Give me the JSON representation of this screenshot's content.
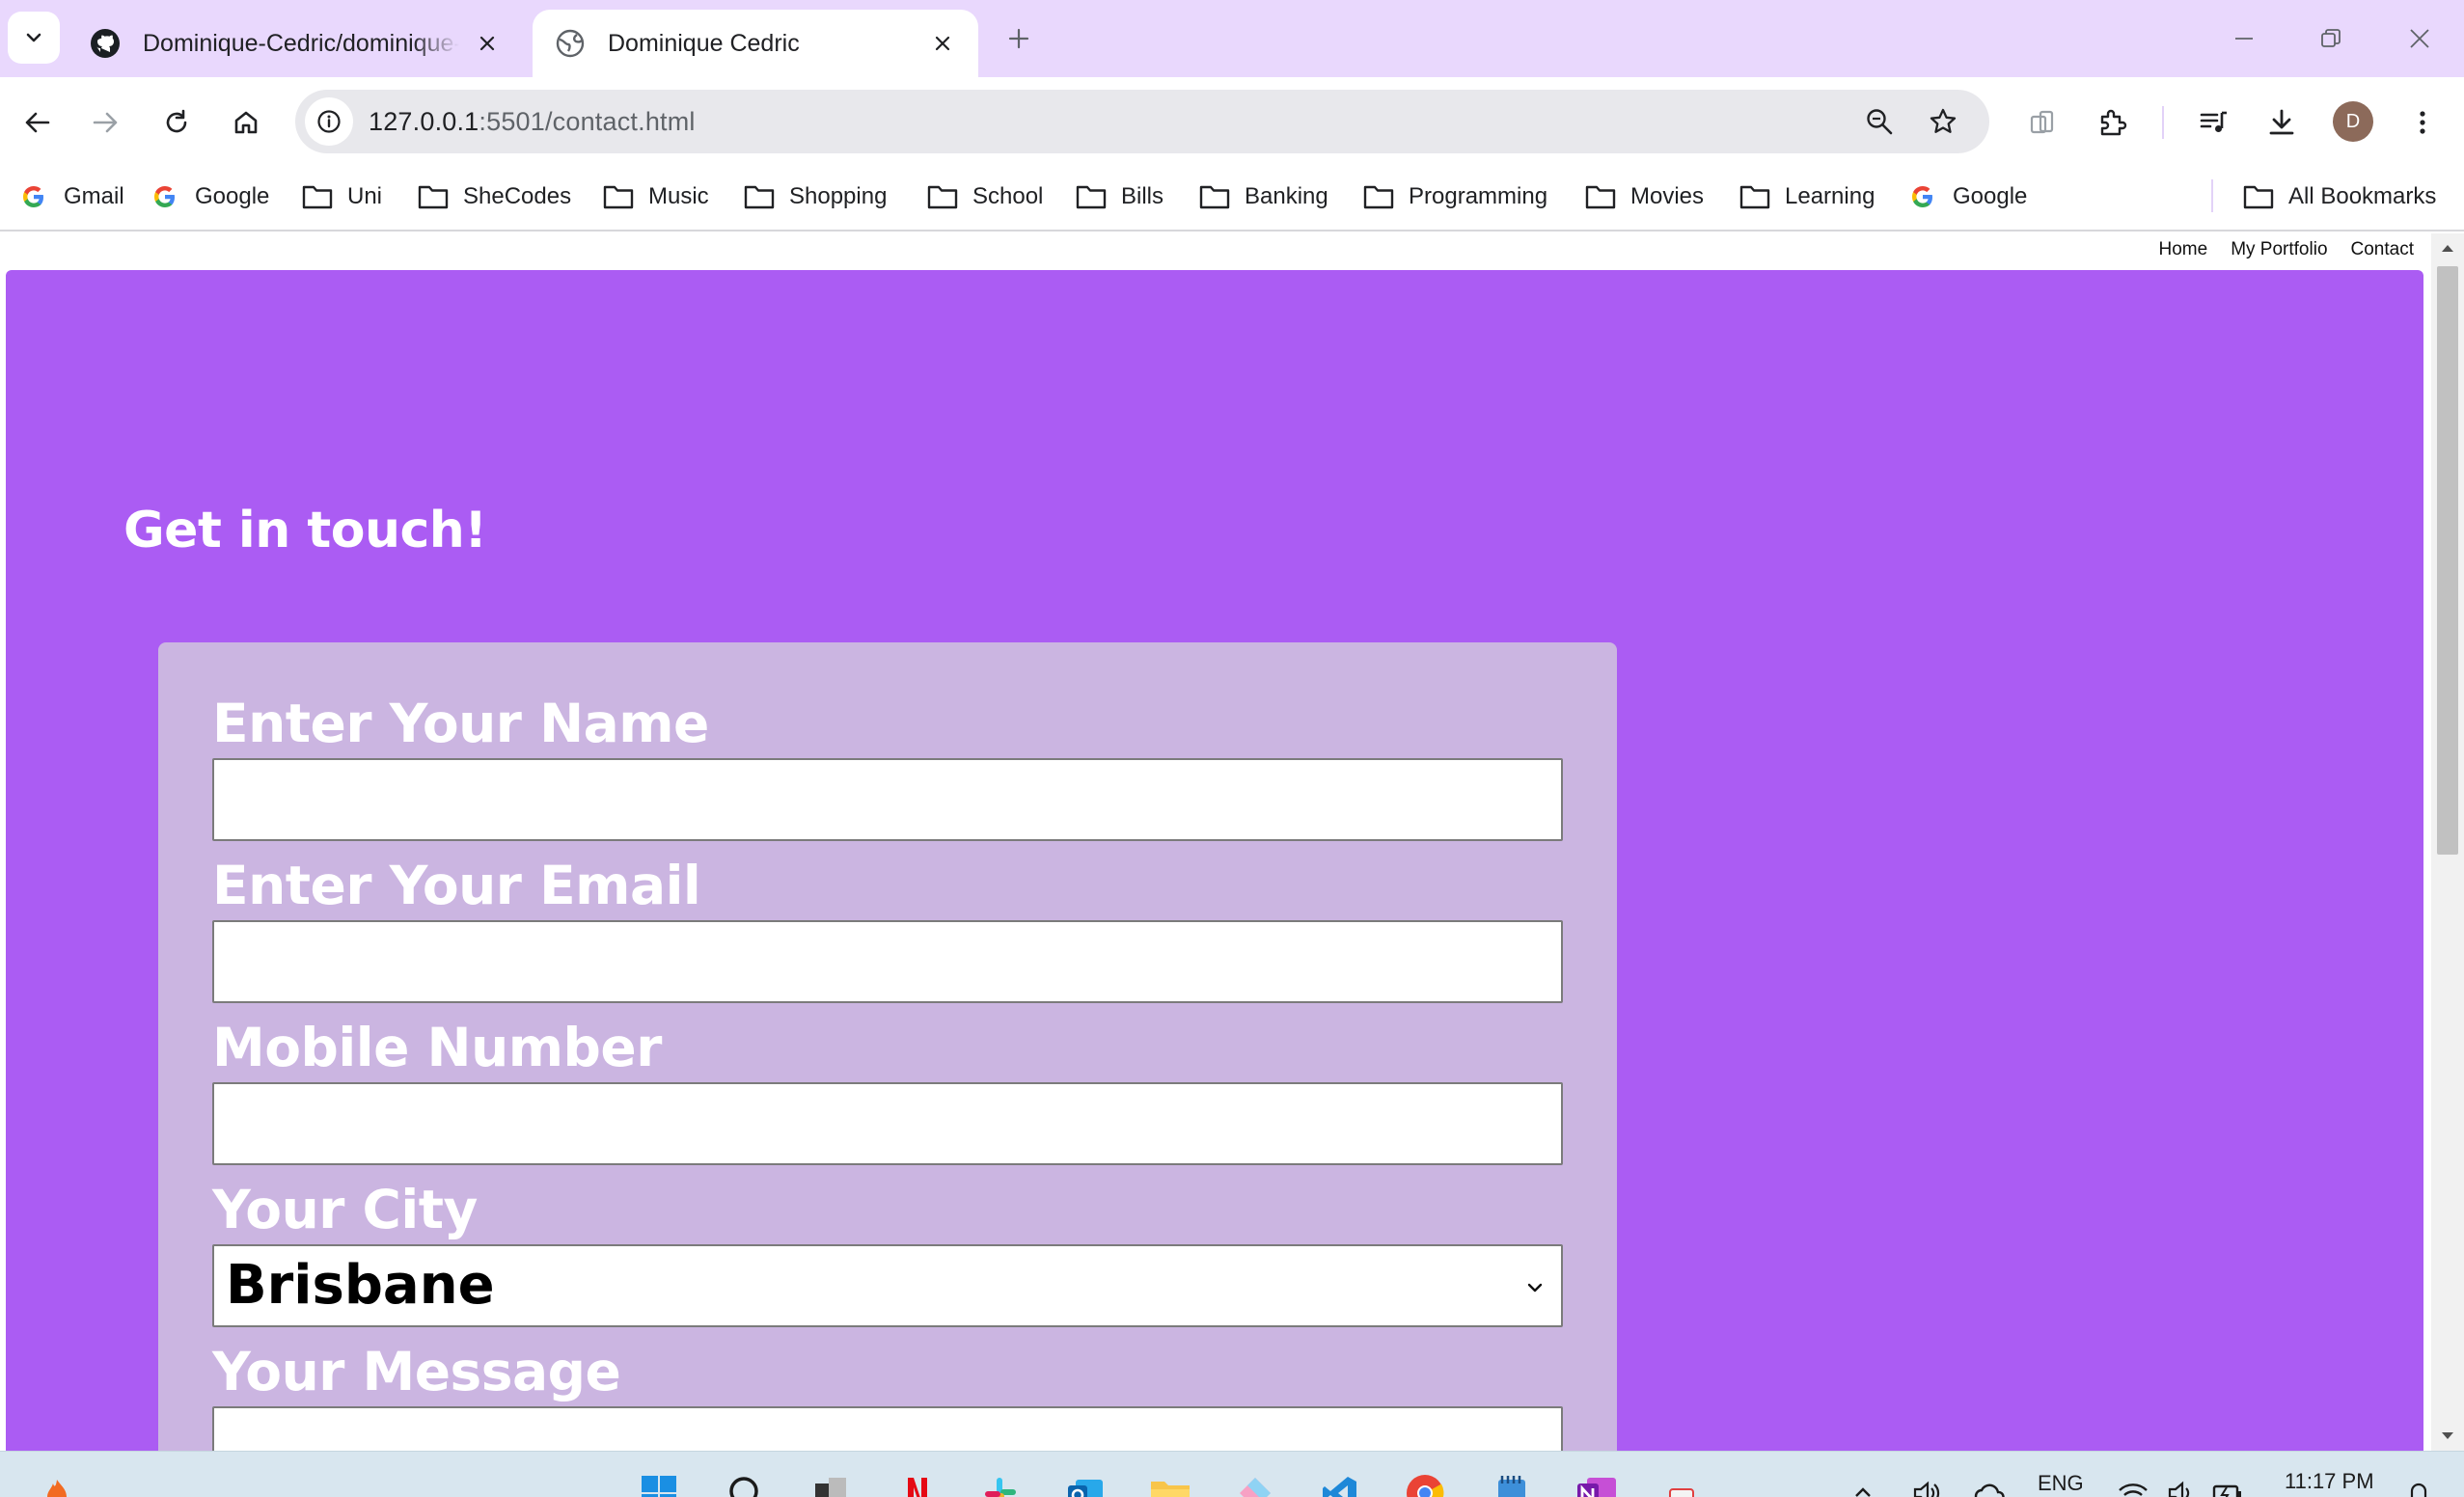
{
  "browser": {
    "tabs": [
      {
        "title": "Dominique-Cedric/dominique-c",
        "icon": "github-icon",
        "active": false
      },
      {
        "title": "Dominique Cedric",
        "icon": "globe-icon",
        "active": true
      }
    ],
    "address": {
      "host": "127.0.0.1",
      "path": ":5501/contact.html"
    },
    "profile_initial": "D",
    "bookmarks": [
      {
        "label": "Gmail",
        "icon": "google-icon"
      },
      {
        "label": "Google",
        "icon": "google-icon"
      },
      {
        "label": "Uni",
        "icon": "folder-icon"
      },
      {
        "label": "SheCodes",
        "icon": "folder-icon"
      },
      {
        "label": "Music",
        "icon": "folder-icon"
      },
      {
        "label": "Shopping",
        "icon": "folder-icon"
      },
      {
        "label": "School",
        "icon": "folder-icon"
      },
      {
        "label": "Bills",
        "icon": "folder-icon"
      },
      {
        "label": "Banking",
        "icon": "folder-icon"
      },
      {
        "label": "Programming",
        "icon": "folder-icon"
      },
      {
        "label": "Movies",
        "icon": "folder-icon"
      },
      {
        "label": "Learning",
        "icon": "folder-icon"
      },
      {
        "label": "Google",
        "icon": "google-icon"
      }
    ],
    "all_bookmarks_label": "All Bookmarks"
  },
  "page": {
    "nav": [
      "Home",
      "My Portfolio",
      "Contact"
    ],
    "heading": "Get in touch!",
    "form": {
      "name_label": "Enter Your Name",
      "email_label": "Enter Your Email",
      "mobile_label": "Mobile Number",
      "city_label": "Your City",
      "city_value": "Brisbane",
      "message_label": "Your Message"
    },
    "colors": {
      "hero_bg": "#ab5cf3",
      "card_bg": "#cbb5e1",
      "titlebar_bg": "#e9d8fd"
    }
  },
  "taskbar": {
    "language": "ENG",
    "time": "11:17 PM"
  }
}
